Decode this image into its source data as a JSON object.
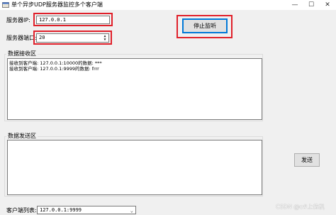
{
  "window": {
    "title": "单个异步UDP服务器监控多个客户端",
    "minimize_glyph": "—",
    "maximize_glyph": "☐",
    "close_glyph": "✕"
  },
  "server": {
    "ip_label": "服务器IP:",
    "ip_value": "127.0.0.1",
    "port_label": "服务器端口:",
    "port_value": "20"
  },
  "stop_button_label": "停止监听",
  "receive_group": {
    "title": "数据接收区",
    "lines": [
      "接收到客户端: 127.0.0.1:10000的数据: ***",
      "接收到客户端: 127.0.0.1:9999的数据: frrr"
    ]
  },
  "send_group": {
    "title": "数据发送区",
    "text": ""
  },
  "send_button_label": "发送",
  "client_list": {
    "label": "客户端列表:",
    "selected": "127.0.0.1:9999"
  },
  "watermark": "CSDN @c#上位机",
  "colors": {
    "highlight_frame": "#e0202a",
    "window_bg": "#f0f0f0"
  }
}
